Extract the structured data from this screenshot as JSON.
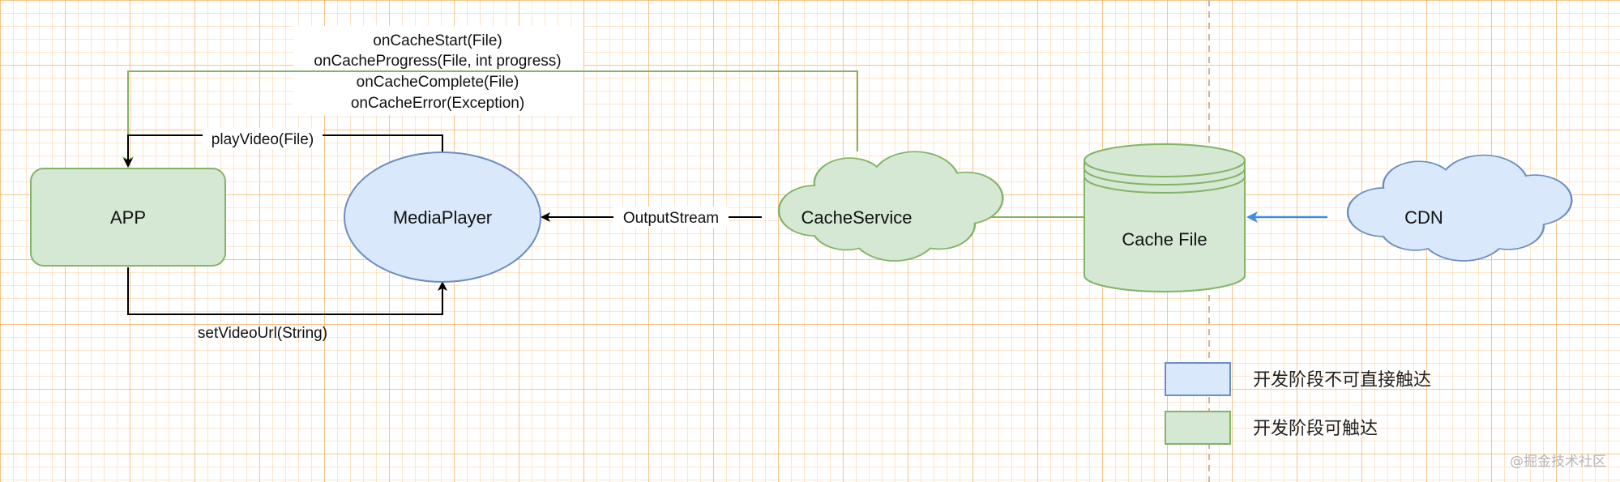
{
  "colors": {
    "green_fill": "#d5e8d4",
    "green_stroke": "#82b366",
    "blue_fill": "#dae8fc",
    "blue_stroke": "#6c8ebf",
    "cdn_arrow": "#3c8fe0",
    "black": "#000000"
  },
  "nodes": {
    "app": "APP",
    "media_player": "MediaPlayer",
    "cache_service": "CacheService",
    "cache_file": "Cache File",
    "cdn": "CDN"
  },
  "edges": {
    "play_video": "playVideo(File)",
    "set_video_url": "setVideoUrl(String)",
    "output_stream": "OutputStream",
    "callbacks": [
      "onCacheStart(File)",
      "onCacheProgress(File, int progress)",
      "onCacheComplete(File)",
      "onCacheError(Exception)"
    ]
  },
  "legend": [
    {
      "label": "开发阶段不可直接触达",
      "color": "blue"
    },
    {
      "label": "开发阶段可触达",
      "color": "green"
    }
  ],
  "watermark": "@掘金技术社区"
}
